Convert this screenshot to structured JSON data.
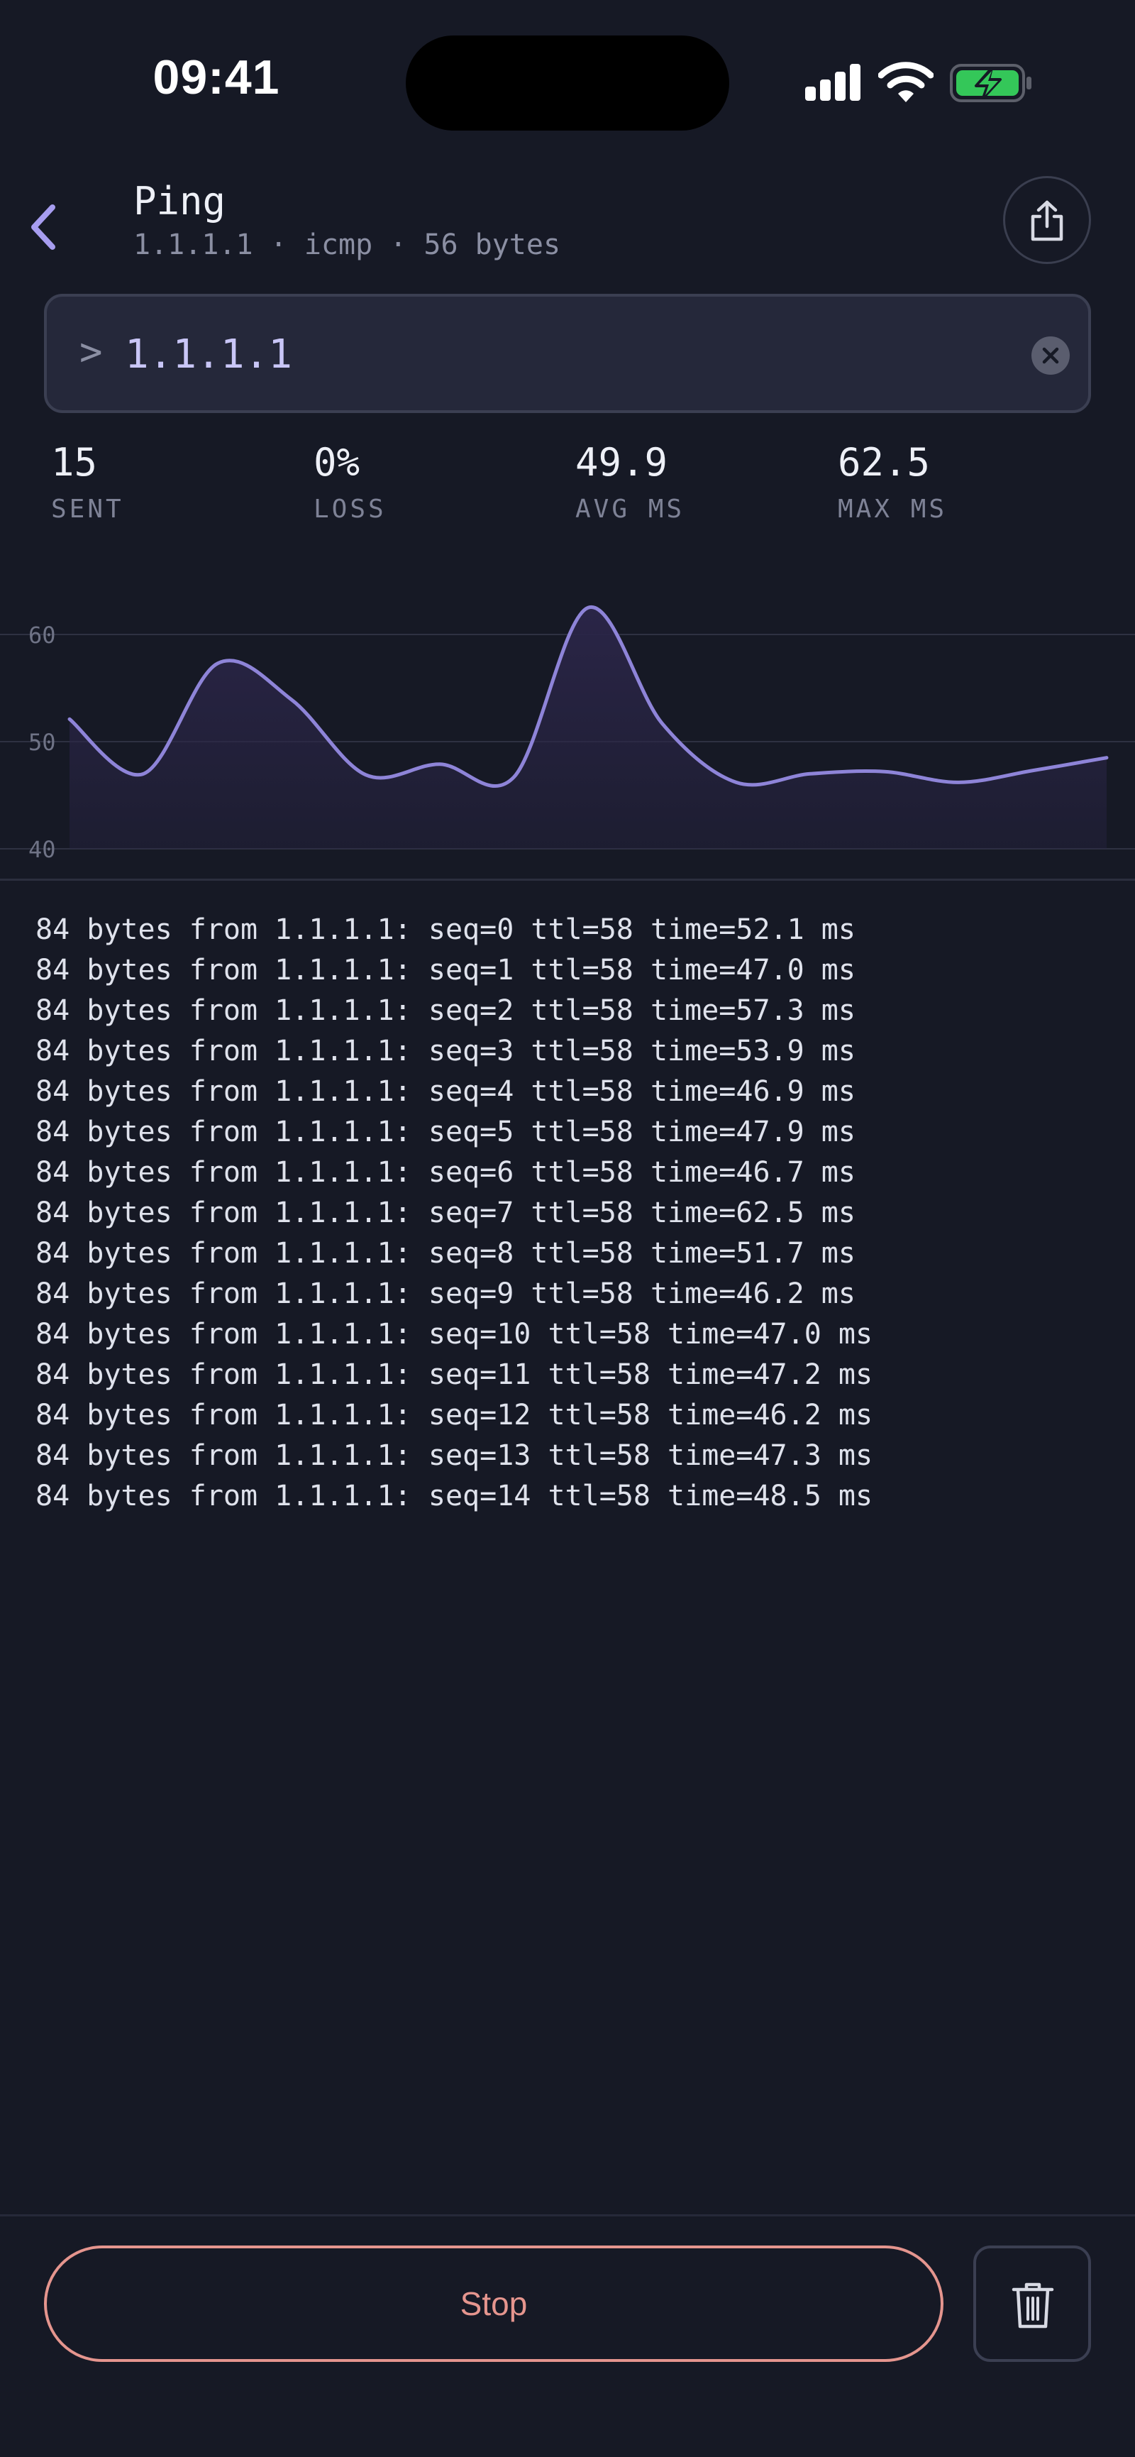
{
  "status_bar": {
    "time": "09:41"
  },
  "header": {
    "title": "Ping",
    "subtitle": "1.1.1.1 · icmp · 56 bytes"
  },
  "command": {
    "prompt": ">",
    "value": "1.1.1.1"
  },
  "stats": [
    {
      "value": "15",
      "label": "SENT"
    },
    {
      "value": "0%",
      "label": "LOSS"
    },
    {
      "value": "49.9",
      "label": "AVG MS"
    },
    {
      "value": "62.5",
      "label": "MAX MS"
    }
  ],
  "chart_data": {
    "type": "area",
    "x": [
      0,
      1,
      2,
      3,
      4,
      5,
      6,
      7,
      8,
      9,
      10,
      11,
      12,
      13,
      14
    ],
    "series": [
      {
        "values": [
          52.1,
          47.0,
          57.3,
          53.9,
          46.9,
          47.9,
          46.7,
          62.5,
          51.7,
          46.2,
          47.0,
          47.2,
          46.2,
          47.3,
          48.5
        ]
      }
    ],
    "yticks": [
      "60",
      "50",
      "40"
    ],
    "ylim": [
      40,
      60
    ],
    "grid": true,
    "colors": {
      "line": "#8e84d8",
      "fill": "#2a2547",
      "grid": "#2e3142",
      "tick": "#6f7386"
    }
  },
  "log_lines": [
    "84 bytes from 1.1.1.1: seq=0 ttl=58 time=52.1 ms",
    "84 bytes from 1.1.1.1: seq=1 ttl=58 time=47.0 ms",
    "84 bytes from 1.1.1.1: seq=2 ttl=58 time=57.3 ms",
    "84 bytes from 1.1.1.1: seq=3 ttl=58 time=53.9 ms",
    "84 bytes from 1.1.1.1: seq=4 ttl=58 time=46.9 ms",
    "84 bytes from 1.1.1.1: seq=5 ttl=58 time=47.9 ms",
    "84 bytes from 1.1.1.1: seq=6 ttl=58 time=46.7 ms",
    "84 bytes from 1.1.1.1: seq=7 ttl=58 time=62.5 ms",
    "84 bytes from 1.1.1.1: seq=8 ttl=58 time=51.7 ms",
    "84 bytes from 1.1.1.1: seq=9 ttl=58 time=46.2 ms",
    "84 bytes from 1.1.1.1: seq=10 ttl=58 time=47.0 ms",
    "84 bytes from 1.1.1.1: seq=11 ttl=58 time=47.2 ms",
    "84 bytes from 1.1.1.1: seq=12 ttl=58 time=46.2 ms",
    "84 bytes from 1.1.1.1: seq=13 ttl=58 time=47.3 ms",
    "84 bytes from 1.1.1.1: seq=14 ttl=58 time=48.5 ms"
  ],
  "actions": {
    "stop_label": "Stop"
  },
  "icons": {
    "back": "chevron-left-icon",
    "share": "share-icon",
    "clear": "clear-icon",
    "trash": "trash-icon"
  },
  "colors": {
    "background": "#161925",
    "accent": "#8e84d8",
    "stop": "#e5958e",
    "battery": "#34c759"
  }
}
